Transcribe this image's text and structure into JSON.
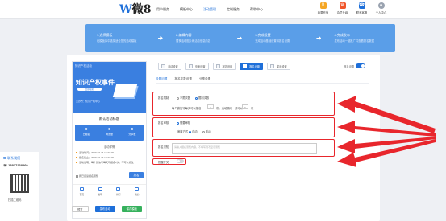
{
  "nav": {
    "logo": "W",
    "logo_num": "微8",
    "links": [
      "用户服务",
      "模板中心",
      "活动管理",
      "定制服务",
      "帮助中心"
    ],
    "active_index": 2,
    "icons": [
      {
        "label": "我要充值",
        "icon": "coin-icon",
        "color": "#f5a623"
      },
      {
        "label": "会员升级",
        "icon": "crown-icon",
        "color": "#f0552a"
      },
      {
        "label": "联系客服",
        "icon": "service-icon",
        "color": "#1e6fd9"
      },
      {
        "label": "个人中心",
        "icon": "user-icon",
        "color": "#9aa3b0"
      }
    ]
  },
  "banner": {
    "steps": [
      {
        "title": "1.选择模板",
        "desc": "在模板库中选择适合您的活动模板"
      },
      {
        "title": "2.编辑内容",
        "desc": "替换活动图片和活动信息内容"
      },
      {
        "title": "3.完成设置",
        "desc": "完成活动基础设置和报名设置"
      },
      {
        "title": "4.完成发布",
        "desc": "发布活动一键推广并查看报名数据"
      }
    ]
  },
  "preview": {
    "top_text": "知识产权活动",
    "title": "知识产权事件",
    "pill": "立即报名",
    "sub": "主办方：知识产权中心",
    "activity_name": "默认活动标题",
    "stats": [
      {
        "num": "0",
        "label": "已报名"
      },
      {
        "num": "0",
        "label": "浏览量"
      },
      {
        "num": "0",
        "label": "分享数"
      }
    ],
    "detail_title": "活动详情",
    "details": [
      "活动时间：2019-03-24 16:37:15",
      "报名截止：2019-03-27 17:37:15",
      "活动说明：每个微信号每天可报名1次，不可以修改"
    ],
    "agree": "我已阅读报名须知",
    "signup": "报名",
    "tabs": [
      "首页",
      "说明",
      "排行",
      "我的"
    ]
  },
  "bottom_buttons": {
    "preview": "预览",
    "publish": "发布活动",
    "save": "保存模板"
  },
  "setting_tabs": [
    "活动设置",
    "页面设置",
    "报名设置",
    "报名设置",
    "奖品设置"
  ],
  "active_setting_tab": 3,
  "toggle_label": "报名设置",
  "sub_tabs": [
    "设置问题",
    "报名次数设置",
    "分享设置"
  ],
  "active_sub_tab": 0,
  "form": {
    "limit_label": "报名限制",
    "limit_opt1": "不限次数",
    "limit_opt2": "限制次数",
    "limit_row_prefix": "每个微信号每天可以报名",
    "limit_num1": "1",
    "limit_mid": "次，活动期间一共可以",
    "limit_num2": "1",
    "limit_suffix": "次",
    "verify_label": "报名审核",
    "verify_opt": "需要审核",
    "verify_sub": "审核方式",
    "verify_sub_opt1": "自动",
    "verify_sub_opt2": "手动",
    "notice_label": "报名须知",
    "notice_placeholder": "请输入报名须知内容，不填写则不显示须知",
    "switch_label": "提醒开关"
  },
  "customer_service": {
    "title": "联系我们",
    "phone": "15837238860",
    "qr_caption": "扫描二维码"
  }
}
